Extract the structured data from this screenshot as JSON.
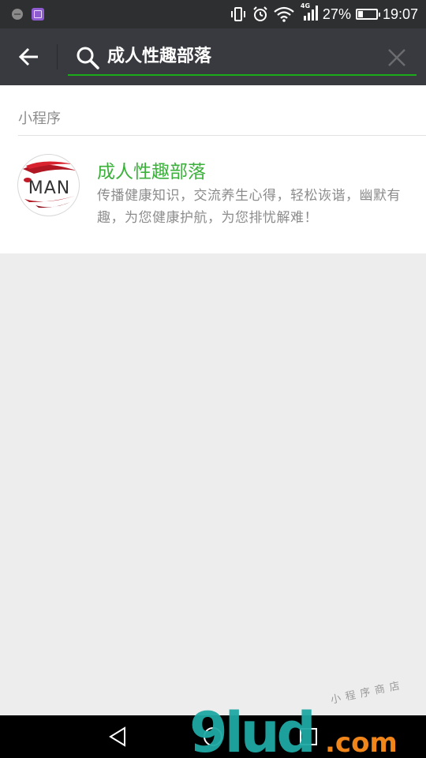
{
  "status_bar": {
    "network_type": "4G",
    "battery_percent": "27%",
    "battery_level": 0.27,
    "time": "19:07"
  },
  "search": {
    "query": "成人性趣部落"
  },
  "results": {
    "section_label": "小程序",
    "items": [
      {
        "title": "成人性趣部落",
        "description": "传播健康知识，交流养生心得，轻松诙谐，幽默有趣，为您健康护航，为您排忧解难！",
        "avatar_text": "MAN"
      }
    ]
  },
  "watermark": {
    "logo_text": "9lud.com",
    "tagline": "小程序商店"
  },
  "colors": {
    "status_bar_bg": "#2e2f31",
    "header_bg": "#393a3f",
    "accent_green": "#1aad19",
    "title_green": "#3bb13b",
    "page_bg": "#ededed",
    "watermark_teal": "#1fa9a3",
    "watermark_orange": "#f08519"
  }
}
